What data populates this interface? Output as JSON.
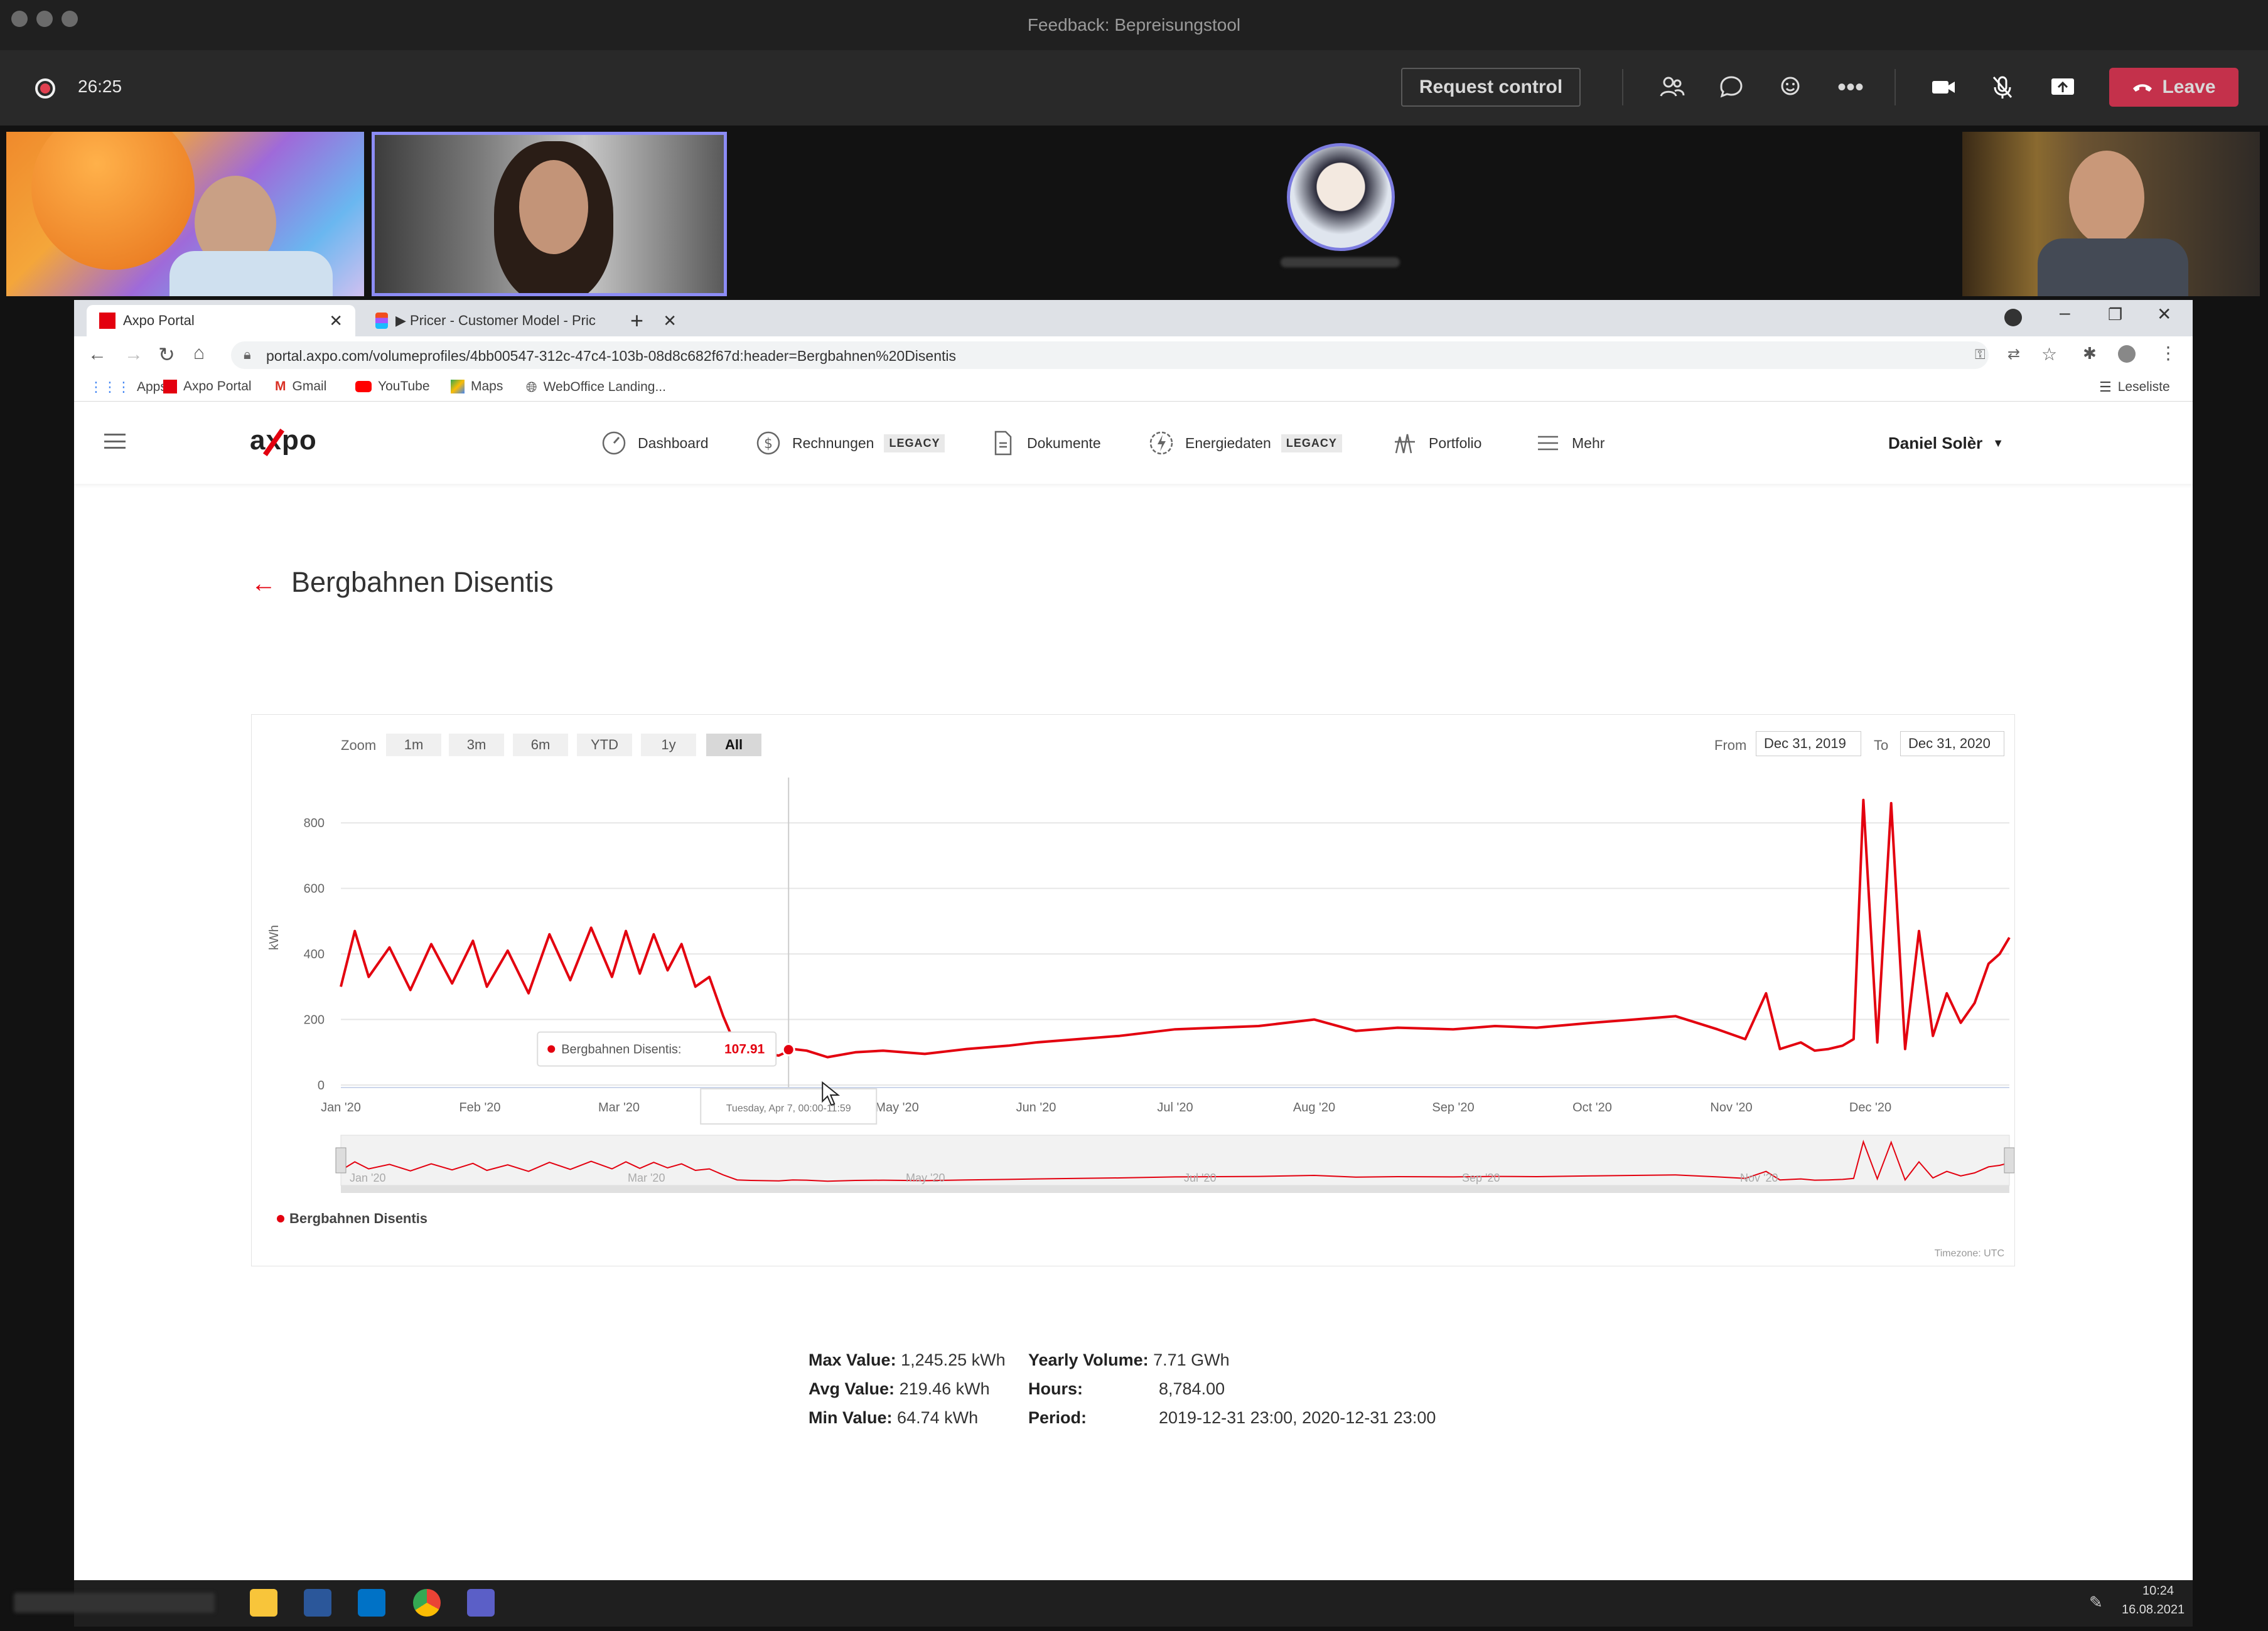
{
  "teams": {
    "window_title": "Feedback: Bepreisungstool",
    "timer": "26:25",
    "request_control_label": "Request control",
    "leave_label": "Leave"
  },
  "browser": {
    "tabs": [
      {
        "label": "Axpo Portal",
        "active": true
      },
      {
        "label": "▶ Pricer - Customer Model - Pric",
        "active": false
      }
    ],
    "url": "portal.axpo.com/volumeprofiles/4bb00547-312c-47c4-103b-08d8c682f67d:header=Bergbahnen%20Disentis",
    "bookmarks": [
      "Apps",
      "Axpo Portal",
      "Gmail",
      "YouTube",
      "Maps",
      "WebOffice Landing..."
    ],
    "reading_list": "Leseliste"
  },
  "app": {
    "logo": "axpo",
    "nav": [
      {
        "label": "Dashboard",
        "badge": ""
      },
      {
        "label": "Rechnungen",
        "badge": "LEGACY"
      },
      {
        "label": "Dokumente",
        "badge": ""
      },
      {
        "label": "Energiedaten",
        "badge": "LEGACY"
      },
      {
        "label": "Portfolio",
        "badge": ""
      },
      {
        "label": "Mehr",
        "badge": ""
      }
    ],
    "user": "Daniel Solèr",
    "page_title": "Bergbahnen Disentis"
  },
  "chart_controls": {
    "zoom_label": "Zoom",
    "zoom_options": [
      "1m",
      "3m",
      "6m",
      "YTD",
      "1y",
      "All"
    ],
    "zoom_selected": "All",
    "from_label": "From",
    "from_value": "Dec 31, 2019",
    "to_label": "To",
    "to_value": "Dec 31, 2020",
    "timezone": "Timezone: UTC",
    "tooltip_series": "Bergbahnen Disentis:",
    "tooltip_value": "107.91",
    "tooltip_date": "Tuesday, Apr 7, 00:00-11:59"
  },
  "chart_data": {
    "type": "line",
    "ylabel": "kWh",
    "ylim": [
      0,
      900
    ],
    "yticks": [
      0,
      200,
      400,
      600,
      800
    ],
    "xticks": [
      "Jan '20",
      "Feb '20",
      "Mar '20",
      "Apr '20",
      "May '20",
      "Jun '20",
      "Jul '20",
      "Aug '20",
      "Sep '20",
      "Oct '20",
      "Nov '20",
      "Dec '20"
    ],
    "navigator_ticks": [
      "Jan '20",
      "Mar '20",
      "May '20",
      "Jul '20",
      "Sep '20",
      "Nov '20"
    ],
    "grid": true,
    "legend": "bottom-left",
    "series": [
      {
        "name": "Bergbahnen Disentis",
        "color": "#e3000f",
        "x_months": [
          0,
          0.1,
          0.2,
          0.35,
          0.5,
          0.65,
          0.8,
          0.95,
          1.05,
          1.2,
          1.35,
          1.5,
          1.65,
          1.8,
          1.95,
          2.05,
          2.15,
          2.25,
          2.35,
          2.45,
          2.55,
          2.65,
          2.75,
          2.85,
          2.95,
          3.05,
          3.15,
          3.25,
          3.35,
          3.5,
          3.7,
          3.9,
          4.2,
          4.5,
          4.8,
          5.0,
          5.3,
          5.6,
          6.0,
          6.3,
          6.6,
          7.0,
          7.3,
          7.6,
          8.0,
          8.3,
          8.6,
          9.0,
          9.3,
          9.6,
          9.9,
          10.1,
          10.25,
          10.35,
          10.5,
          10.6,
          10.7,
          10.8,
          10.88,
          10.95,
          11.05,
          11.15,
          11.25,
          11.35,
          11.45,
          11.55,
          11.65,
          11.75,
          11.85,
          11.93,
          12.0
        ],
        "values": [
          300,
          470,
          330,
          420,
          290,
          430,
          310,
          440,
          300,
          410,
          280,
          460,
          320,
          480,
          330,
          470,
          340,
          460,
          350,
          430,
          300,
          330,
          210,
          110,
          100,
          95,
          90,
          110,
          105,
          85,
          100,
          105,
          95,
          110,
          120,
          130,
          140,
          150,
          170,
          175,
          180,
          200,
          165,
          175,
          170,
          180,
          175,
          190,
          200,
          210,
          170,
          140,
          280,
          110,
          130,
          105,
          110,
          120,
          140,
          870,
          130,
          860,
          110,
          470,
          150,
          280,
          190,
          250,
          370,
          400,
          450
        ]
      }
    ],
    "stats": {
      "max_label": "Max Value:",
      "max_value": "1,245.25 kWh",
      "avg_label": "Avg Value:",
      "avg_value": "219.46 kWh",
      "min_label": "Min Value:",
      "min_value": "64.74 kWh",
      "yearly_label": "Yearly Volume:",
      "yearly_value": "7.71 GWh",
      "hours_label": "Hours:",
      "hours_value": "8,784.00",
      "period_label": "Period:",
      "period_value": "2019-12-31 23:00, 2020-12-31 23:00"
    }
  },
  "taskbar": {
    "time": "10:24",
    "date": "16.08.2021"
  }
}
